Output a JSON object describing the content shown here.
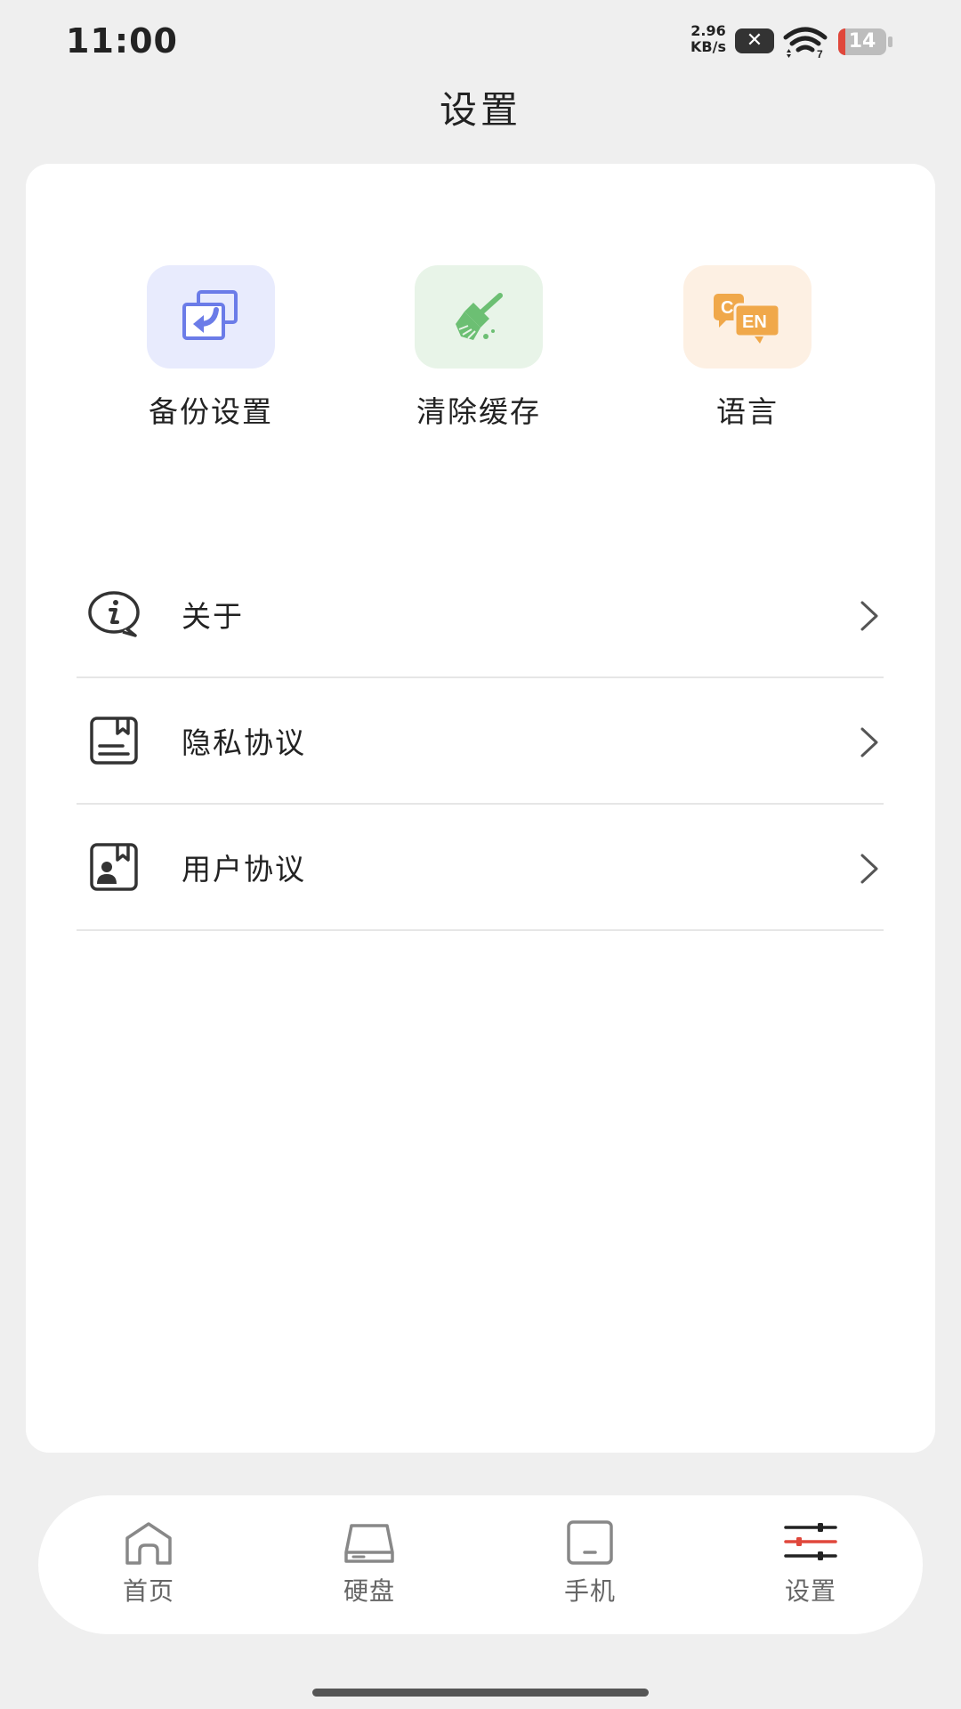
{
  "status_bar": {
    "time": "11:00",
    "net_speed_value": "2.96",
    "net_speed_unit": "KB/s",
    "notification_badge": "✕",
    "wifi_label": "7",
    "battery_level": "14",
    "battery_level_fraction": 0.14,
    "battery_low_color": "#e0473b"
  },
  "header": {
    "title": "设置"
  },
  "quick_actions": [
    {
      "label": "备份设置",
      "icon": "backup-icon",
      "bg": "#e8ebfd",
      "color": "#6b7ce8"
    },
    {
      "label": "清除缓存",
      "icon": "broom-icon",
      "bg": "#e8f4e8",
      "color": "#6cbf73"
    },
    {
      "label": "语言",
      "icon": "language-icon",
      "bg": "#fdf0e3",
      "color": "#f0a84a"
    }
  ],
  "language_icon_text": {
    "left": "C",
    "right": "EN"
  },
  "menu": [
    {
      "label": "关于",
      "icon": "info-icon"
    },
    {
      "label": "隐私协议",
      "icon": "privacy-document-icon"
    },
    {
      "label": "用户协议",
      "icon": "user-agreement-icon"
    }
  ],
  "bottom_nav": [
    {
      "label": "首页",
      "icon": "home-icon",
      "active": false
    },
    {
      "label": "硬盘",
      "icon": "hard-drive-icon",
      "active": false
    },
    {
      "label": "手机",
      "icon": "phone-icon",
      "active": false
    },
    {
      "label": "设置",
      "icon": "settings-sliders-icon",
      "active": true
    }
  ],
  "colors": {
    "accent": "#e0473b",
    "background": "#efefef",
    "card": "#ffffff"
  }
}
